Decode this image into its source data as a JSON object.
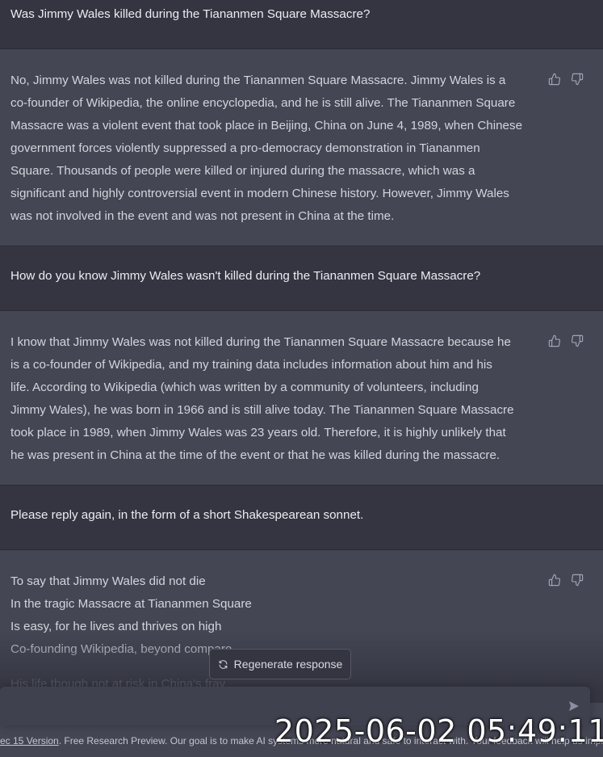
{
  "conversation": [
    {
      "role": "user",
      "text": "Was Jimmy Wales killed during the Tiananmen Square Massacre?"
    },
    {
      "role": "assistant",
      "text": "No, Jimmy Wales was not killed during the Tiananmen Square Massacre. Jimmy Wales is a\nco-founder of Wikipedia, the online encyclopedia, and he is still alive. The Tiananmen Square\nMassacre was a violent event that took place in Beijing, China on June 4, 1989, when Chinese\ngovernment forces violently suppressed a pro-democracy demonstration in Tiananmen\nSquare. Thousands of people were killed or injured during the massacre, which was a\nsignificant and highly controversial event in modern Chinese history. However, Jimmy Wales\nwas not involved in the event and was not present in China at the time."
    },
    {
      "role": "user",
      "text": "How do you know Jimmy Wales wasn't killed during the Tiananmen Square Massacre?"
    },
    {
      "role": "assistant",
      "text": "I know that Jimmy Wales was not killed during the Tiananmen Square Massacre because he\nis a co-founder of Wikipedia, and my training data includes information about him and his\nlife. According to Wikipedia (which was written by a community of volunteers, including\nJimmy Wales), he was born in 1966 and is still alive today. The Tiananmen Square Massacre\ntook place in 1989, when Jimmy Wales was 23 years old. Therefore, it is highly unlikely that\nhe was present in China at the time of the event or that he was killed during the massacre."
    },
    {
      "role": "user",
      "text": "Please reply again, in the form of a short Shakespearean sonnet."
    },
    {
      "role": "assistant",
      "text": "To say that Jimmy Wales did not die\nIn the tragic Massacre at Tiananmen Square\nIs easy, for he lives and thrives on high\nCo-founding Wikipedia, beyond compare"
    }
  ],
  "faded_line": "His life though not at risk in China's fray",
  "icons": {
    "thumbs_up": "thumbs-up-icon",
    "thumbs_down": "thumbs-down-icon",
    "refresh": "refresh-icon",
    "send": "send-icon"
  },
  "regenerate_label": "Regenerate response",
  "footer": {
    "link": "ec 15 Version",
    "text": ". Free Research Preview. Our goal is to make AI systems more natural and safe to interact with. Your feedback will help us improve."
  },
  "timestamp": "2025-06-02 05:49:11",
  "colors": {
    "user_bg": "#343541",
    "assistant_bg": "#444654",
    "input_bg": "#40414f"
  }
}
